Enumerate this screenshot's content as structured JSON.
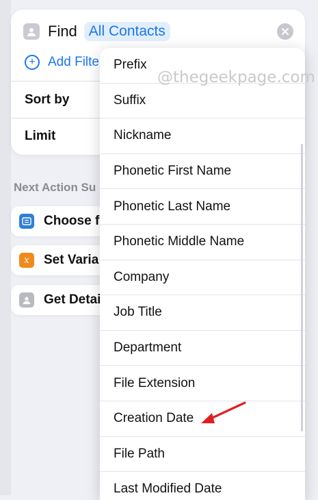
{
  "find_action": {
    "find_label": "Find",
    "token_label": "All Contacts",
    "add_filter_label": "Add Filter",
    "sort_by_label": "Sort by",
    "limit_label": "Limit"
  },
  "next_actions": {
    "heading": "Next Action Su",
    "items": [
      {
        "label": "Choose f",
        "icon": "contact-card-icon",
        "color": "#2f7fd6"
      },
      {
        "label": "Set Varia",
        "icon": "variable-x-icon",
        "color": "#f08a1c"
      },
      {
        "label": "Get Detai",
        "icon": "contact-person-icon",
        "color": "#b8bac0"
      }
    ]
  },
  "dropdown_menu": {
    "items": [
      "Prefix",
      "Suffix",
      "Nickname",
      "Phonetic First Name",
      "Phonetic Last Name",
      "Phonetic Middle Name",
      "Company",
      "Job Title",
      "Department",
      "File Extension",
      "Creation Date",
      "File Path",
      "Last Modified Date"
    ],
    "highlighted_item": "Creation Date"
  },
  "watermark": "@thegeekpage.com",
  "colors": {
    "accent": "#1877f2",
    "arrow": "#e02020",
    "background": "#eef0f5"
  }
}
